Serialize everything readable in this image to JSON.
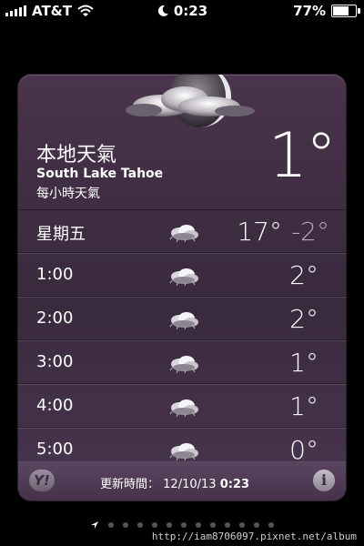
{
  "status_bar": {
    "carrier": "AT&T",
    "time": "0:23",
    "battery": "77%",
    "battery_level": 0.77
  },
  "widget": {
    "location_title": "本地天氣",
    "location_name": "South Lake Tahoe",
    "subtitle": "每小時天氣",
    "current_temp": "1°",
    "hero_icon": "moon-cloud-icon"
  },
  "day_row": {
    "label": "星期五",
    "icon": "cloudy-night-icon",
    "high": "17°",
    "low": "-2°"
  },
  "hourly": [
    {
      "time": "1:00",
      "icon": "cloudy-night-icon",
      "temp": "2°"
    },
    {
      "time": "2:00",
      "icon": "cloudy-night-icon",
      "temp": "2°"
    },
    {
      "time": "3:00",
      "icon": "cloudy-night-icon",
      "temp": "1°"
    },
    {
      "time": "4:00",
      "icon": "cloudy-night-icon",
      "temp": "1°"
    },
    {
      "time": "5:00",
      "icon": "cloudy-night-icon",
      "temp": "0°"
    }
  ],
  "footer": {
    "yahoo_label": "Y!",
    "updated_label": "更新時間：",
    "updated_date": "12/10/13",
    "updated_time": "0:23",
    "info_label": "i"
  },
  "watermark": "http://iam8706097.pixnet.net/album"
}
